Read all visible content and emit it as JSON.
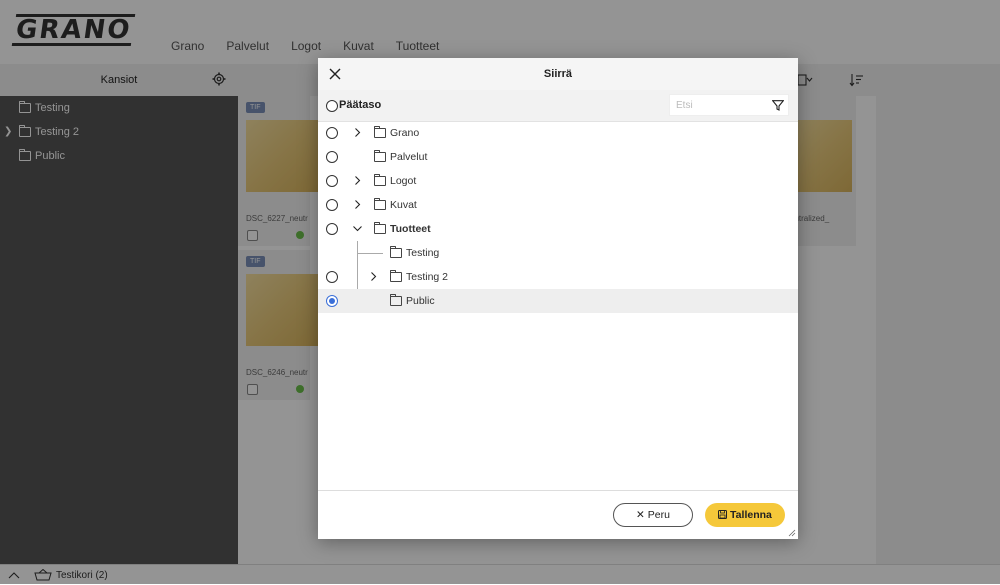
{
  "app": {
    "logo": "GRANO",
    "nav": [
      "Grano",
      "Palvelut",
      "Logot",
      "Kuvat",
      "Tuotteet"
    ]
  },
  "toolbar": {
    "folders_title": "Kansiot"
  },
  "sidebar": {
    "items": [
      {
        "label": "Testing",
        "expandable": false
      },
      {
        "label": "Testing 2",
        "expandable": true
      },
      {
        "label": "Public",
        "expandable": false
      }
    ]
  },
  "cards": [
    {
      "tag": "TIF",
      "filename": "DSC_6227_neutr"
    },
    {
      "tag": "TIF",
      "filename": "DSC_6246_neutr"
    },
    {
      "tag": "",
      "filename": "eutralized_"
    }
  ],
  "bottombar": {
    "basket_label": "Testikori (2)"
  },
  "modal": {
    "title": "Siirrä",
    "root_label": "Päätaso",
    "search_placeholder": "Etsi",
    "tree": [
      {
        "label": "Grano",
        "expandable": true,
        "expanded": false,
        "radio": true,
        "selected": false
      },
      {
        "label": "Palvelut",
        "expandable": false,
        "expanded": false,
        "radio": true,
        "selected": false
      },
      {
        "label": "Logot",
        "expandable": true,
        "expanded": false,
        "radio": true,
        "selected": false
      },
      {
        "label": "Kuvat",
        "expandable": true,
        "expanded": false,
        "radio": true,
        "selected": false
      },
      {
        "label": "Tuotteet",
        "expandable": true,
        "expanded": true,
        "radio": true,
        "selected": false
      },
      {
        "label": "Testing",
        "expandable": false,
        "expanded": false,
        "radio": false,
        "selected": false
      },
      {
        "label": "Testing 2",
        "expandable": true,
        "expanded": false,
        "radio": true,
        "selected": false
      },
      {
        "label": "Public",
        "expandable": false,
        "expanded": false,
        "radio": true,
        "selected": true
      }
    ],
    "cancel_label": "Peru",
    "save_label": "Tallenna"
  },
  "colors": {
    "accent_selected": "#3a6fd8",
    "save_button": "#f5c83a",
    "sidebar_bg": "#555555",
    "status_ok": "#6cc04a"
  }
}
